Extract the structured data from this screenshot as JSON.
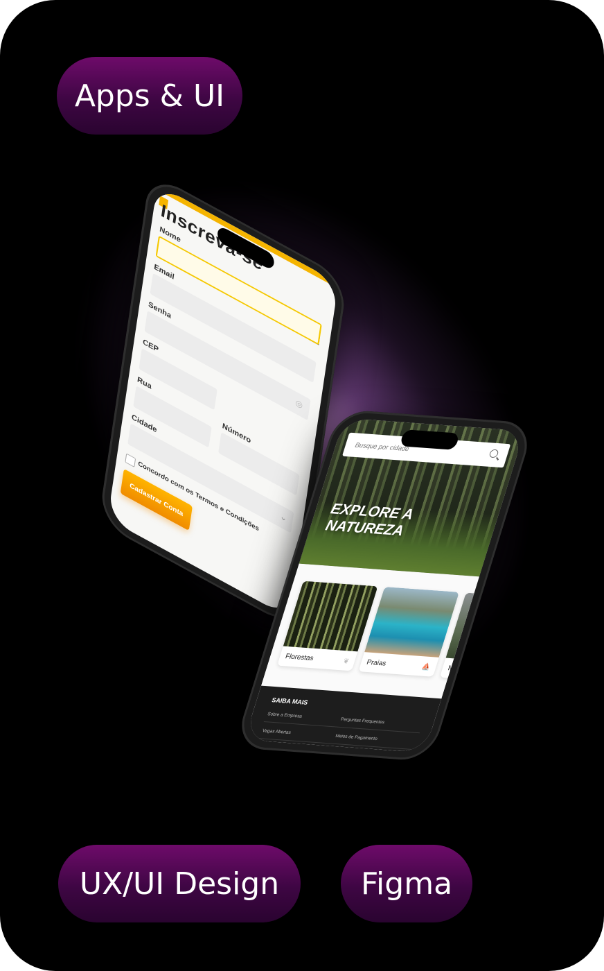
{
  "tags": {
    "top": "Apps & UI",
    "bottom_left": "UX/UI Design",
    "bottom_right": "Figma"
  },
  "signup_screen": {
    "title": "Inscreva-se",
    "fields": {
      "name": "Nome",
      "email": "Email",
      "password": "Senha",
      "zip": "CEP",
      "street": "Rua",
      "number": "Número",
      "city": "Cidade"
    },
    "terms": "Concordo com os Termos e Condições",
    "submit": "Cadastrar Conta"
  },
  "explore_screen": {
    "search_placeholder": "Busque por cidade",
    "headline_line1": "EXPLORE A",
    "headline_line2": "NATUREZA",
    "categories": [
      "Florestas",
      "Praias",
      "M"
    ],
    "footer_title": "SAIBA MAIS",
    "footer_links": [
      "Sobre a Empresa",
      "Perguntas Frequentes",
      "Vagas Abertas",
      "Meios de Pagamento"
    ]
  },
  "colors": {
    "pill_gradient_top": "#6e0b6a",
    "pill_gradient_bottom": "#2a0430",
    "accent_orange": "#f5b400",
    "glow": "#e2a0f0",
    "background": "#000000"
  }
}
